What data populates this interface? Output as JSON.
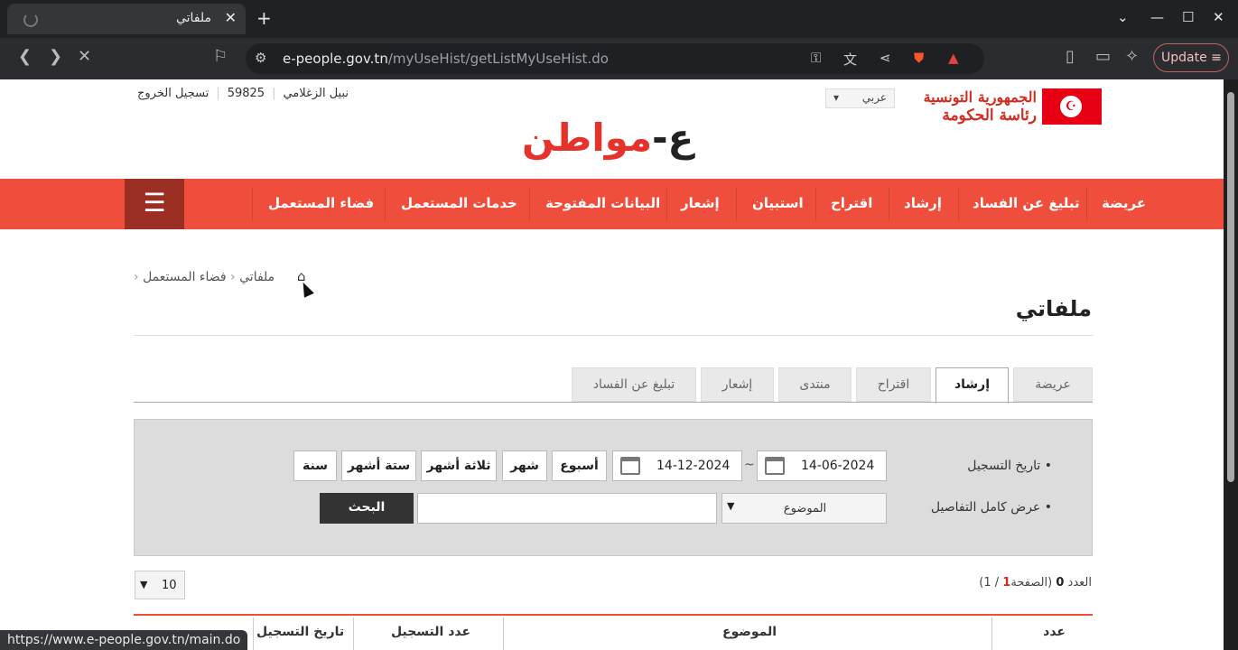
{
  "browser": {
    "tab_title": "ملفاتي",
    "tab_close": "✕",
    "new_tab": "+",
    "url_host": "e-people.gov.tn",
    "url_path": "/myUseHist/getListMyUseHist.do",
    "update_label": "Update",
    "status_url": "https://www.e-people.gov.tn/main.do"
  },
  "header": {
    "gov_line1": "الجمهورية التونسية",
    "gov_line2": "رئاسة الحكومة",
    "language": "عربي",
    "user_name": "نبيل الزغلامي",
    "user_id": "59825",
    "logout": "تسجيل الخروج",
    "logo_main": "مواطن",
    "logo_prefix": "ع-"
  },
  "nav": {
    "items": [
      "عريضة",
      "تبليغ عن الفساد",
      "إرشاد",
      "اقتراح",
      "استبيان",
      "إشعار",
      "البيانات المفتوحة",
      "خدمات المستعمل",
      "فضاء المستعمل"
    ]
  },
  "breadcrumb": {
    "level1": "فضاء المستعمل",
    "level2": "ملفاتي"
  },
  "page_title": "ملفاتي",
  "tabs": [
    "عريضة",
    "إرشاد",
    "اقتراح",
    "منتدى",
    "إشعار",
    "تبليغ عن الفساد"
  ],
  "active_tab": "إرشاد",
  "search": {
    "date_label": "تاريخ التسجيل",
    "details_label": "عرض كامل التفاصيل",
    "date_from": "14-06-2024",
    "date_to": "14-12-2024",
    "tilde": "~",
    "periods": [
      "أسبوع",
      "شهر",
      "ثلاثة أشهر",
      "ستة أشهر",
      "سنة"
    ],
    "subject_option": "الموضوع",
    "search_button": "البحث"
  },
  "results": {
    "count_label": "العدد",
    "count": "0",
    "page_label": "(الصفحة",
    "page": "1",
    "page_total": "/ 1)",
    "page_size": "10"
  },
  "table": {
    "columns": [
      "عدد",
      "الموضوع",
      "عدد التسجيل",
      "تاريخ التسجيل"
    ]
  },
  "colors": {
    "accent": "#ee4e3b",
    "dark_accent": "#9c2f24"
  }
}
